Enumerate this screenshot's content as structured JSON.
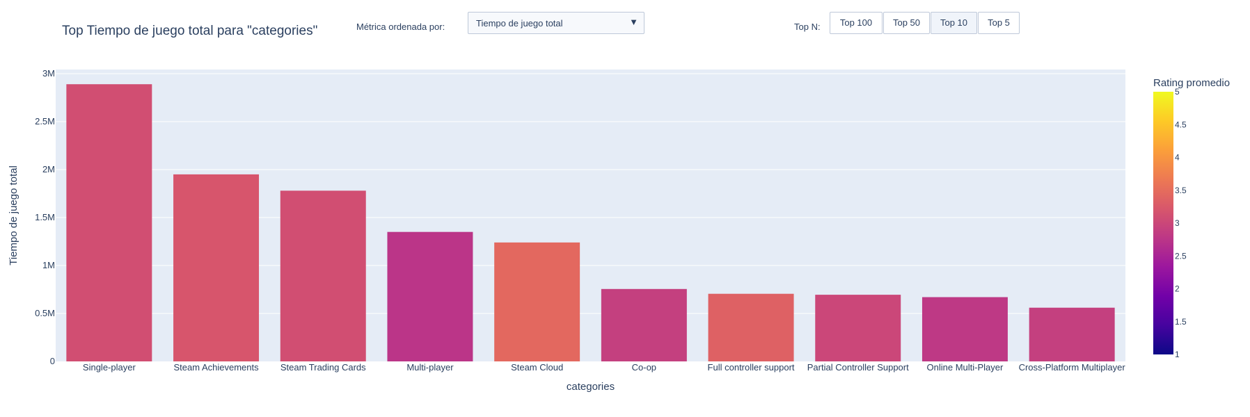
{
  "title": "Top Tiempo de juego total para \"categories\"",
  "controls": {
    "metric_label": "Métrica ordenada por:",
    "metric_value": "Tiempo de juego total",
    "dropdown_arrow": "▼",
    "topn_label": "Top N:",
    "topn_buttons": [
      "Top 100",
      "Top 50",
      "Top 10",
      "Top 5"
    ],
    "active_topn": "Top 10"
  },
  "chart_data": {
    "type": "bar",
    "xlabel": "categories",
    "ylabel": "Tiempo de juego total",
    "ylim": [
      0,
      3000000
    ],
    "yticks": [
      0,
      500000,
      1000000,
      1500000,
      2000000,
      2500000,
      3000000
    ],
    "ytick_labels": [
      "0",
      "0.5M",
      "1M",
      "1.5M",
      "2M",
      "2.5M",
      "3M"
    ],
    "categories": [
      "Single-player",
      "Steam Achievements",
      "Steam Trading Cards",
      "Multi-player",
      "Steam Cloud",
      "Co-op",
      "Full controller support",
      "Partial Controller Support",
      "Online Multi-Player",
      "Cross-Platform Multiplayer"
    ],
    "values": [
      2890000,
      1950000,
      1780000,
      1350000,
      1240000,
      755000,
      705000,
      695000,
      670000,
      560000
    ],
    "color_values": [
      3.1,
      3.2,
      3.1,
      2.75,
      3.45,
      2.9,
      3.35,
      3.0,
      2.8,
      2.9
    ],
    "colorbar": {
      "title": "Rating promedio",
      "range": [
        1,
        5
      ],
      "ticks": [
        1,
        1.5,
        2,
        2.5,
        3,
        3.5,
        4,
        4.5,
        5
      ],
      "tick_labels": [
        "1",
        "1.5",
        "2",
        "2.5",
        "3",
        "3.5",
        "4",
        "4.5",
        "5"
      ],
      "colorscale": [
        "#0d0887",
        "#46039f",
        "#7201a8",
        "#9c179e",
        "#bd3786",
        "#d8576b",
        "#ed7953",
        "#fb9f3a",
        "#fdca26",
        "#f0f921"
      ]
    },
    "plot_bg": "#e5ecf6",
    "grid": true
  }
}
